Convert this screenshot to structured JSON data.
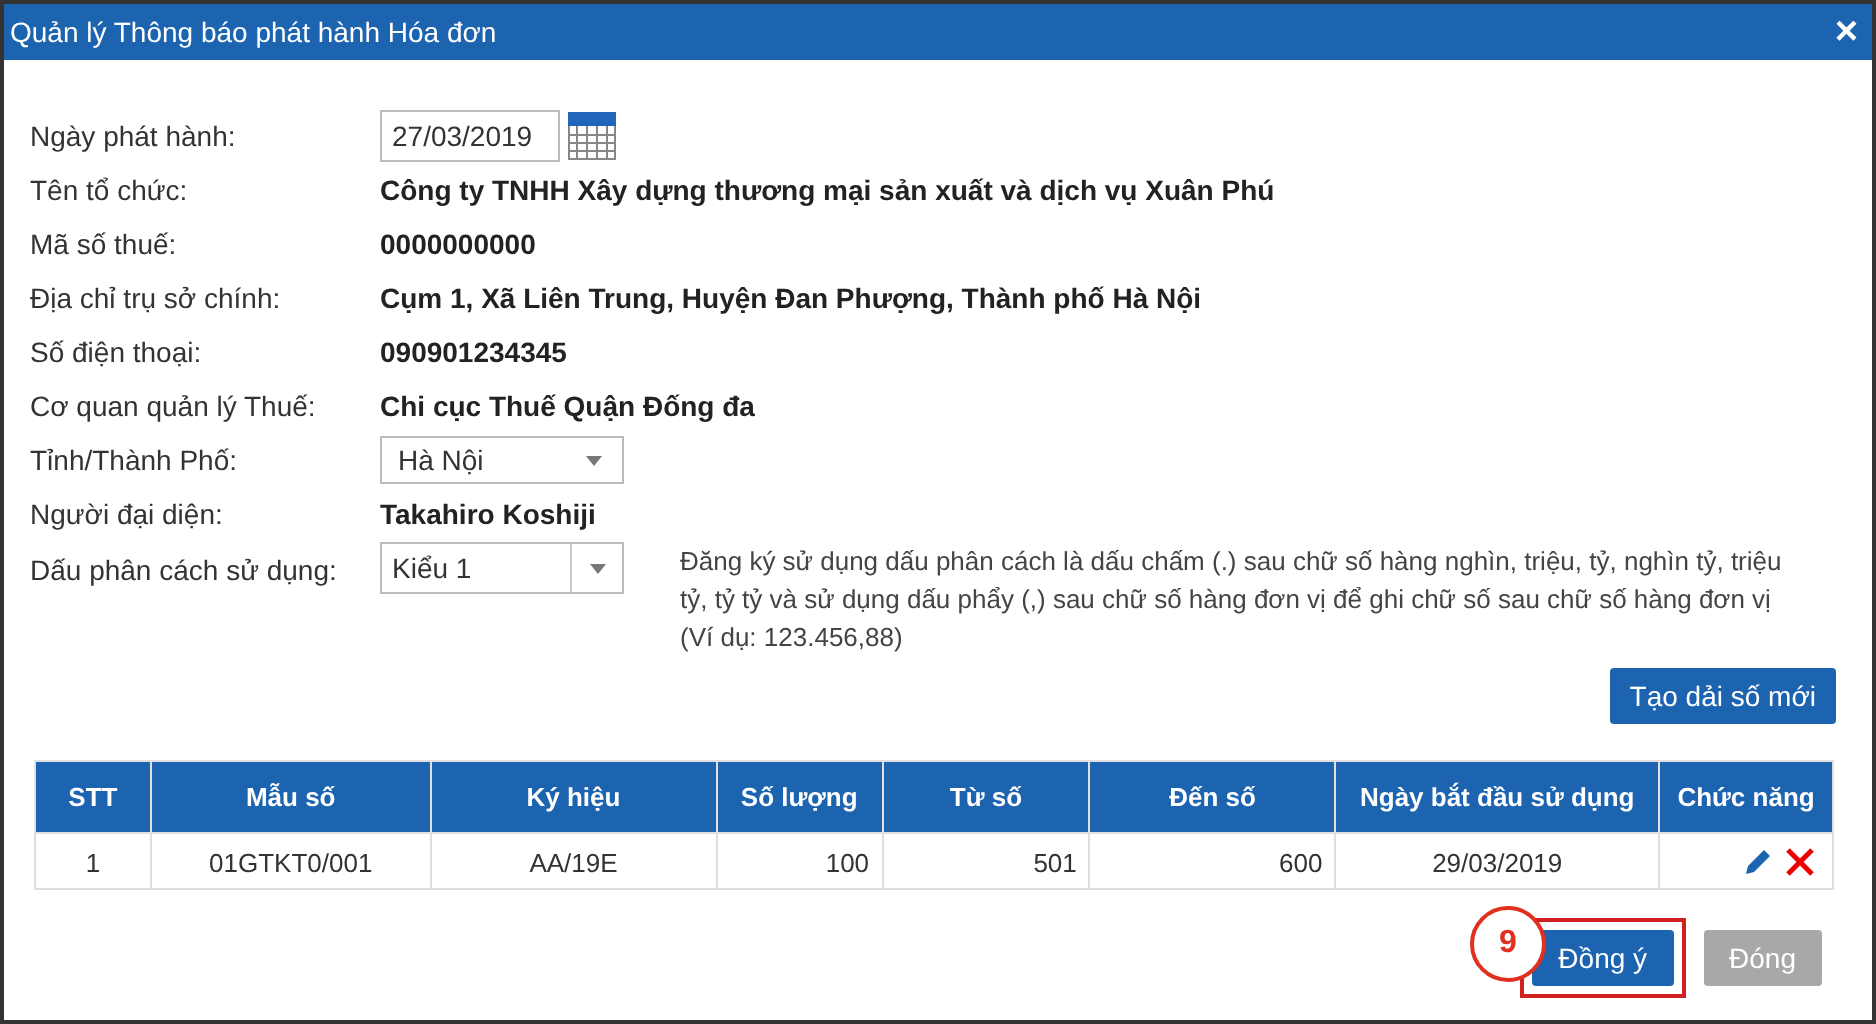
{
  "window": {
    "title": "Quản lý Thông báo phát hành Hóa đơn",
    "close": "×"
  },
  "form": [
    {
      "kind": "date",
      "label": "Ngày phát hành:",
      "value": "27/03/2019"
    },
    {
      "kind": "text",
      "label": "Tên tổ chức:",
      "value": "Công ty TNHH Xây dựng thương mại sản xuất và dịch vụ Xuân Phú"
    },
    {
      "kind": "text",
      "label": "Mã số thuế:",
      "value": "0000000000"
    },
    {
      "kind": "text",
      "label": "Địa chỉ trụ sở chính:",
      "value": "Cụm 1, Xã Liên Trung, Huyện Đan Phượng, Thành phố Hà Nội"
    },
    {
      "kind": "text",
      "label": "Số điện thoại:",
      "value": "090901234345"
    },
    {
      "kind": "text",
      "label": "Cơ quan quản lý Thuế:",
      "value": "Chi cục Thuế Quận Đống đa"
    },
    {
      "kind": "select",
      "label": "Tỉnh/Thành Phố:",
      "value": "Hà Nội"
    },
    {
      "kind": "text",
      "label": "Người đại diện:",
      "value": "Takahiro Koshiji"
    },
    {
      "kind": "select-note",
      "label": "Dấu phân cách sử dụng:",
      "value": "Kiểu 1",
      "note": "Đăng ký sử dụng dấu phân cách là dấu chấm (.) sau chữ số hàng nghìn, triệu, tỷ, nghìn tỷ, triệu tỷ, tỷ tỷ và sử dụng dấu phẩy (,) sau chữ số hàng đơn vị để ghi chữ số sau chữ số hàng đơn vị (Ví dụ: 123.456,88)"
    }
  ],
  "new_range_button": "Tạo dải số mới",
  "table": {
    "columns": [
      "STT",
      "Mẫu số",
      "Ký hiệu",
      "Số lượng",
      "Từ số",
      "Đến số",
      "Ngày bắt đầu sử dụng",
      "Chức năng"
    ],
    "rows": [
      {
        "cells": [
          "1",
          "01GTKT0/001",
          "AA/19E",
          "100",
          "501",
          "600",
          "29/03/2019"
        ]
      }
    ]
  },
  "step_marker": "9",
  "buttons": [
    {
      "label": "Đồng ý",
      "disabled": false,
      "highlighted": true
    },
    {
      "label": "Đóng",
      "disabled": true,
      "highlighted": false
    }
  ]
}
